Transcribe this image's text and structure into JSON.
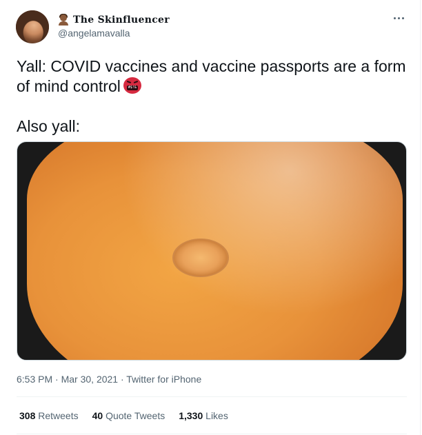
{
  "tweet": {
    "display_name": "The Skinfluencer",
    "handle": "@angelamavalla",
    "text_line1": "Yall:  COVID vaccines and vaccine passports are a form of mind control",
    "text_line2": "Also yall:",
    "emoji_name_icon": "person-icon",
    "emoji_text_icon": "angry-face-with-symbols-icon",
    "time": "6:53 PM",
    "date": "Mar 30, 2021",
    "source": "Twitter for iPhone",
    "separator": "·"
  },
  "stats": {
    "retweets_count": "308",
    "retweets_label": "Retweets",
    "quotes_count": "40",
    "quotes_label": "Quote Tweets",
    "likes_count": "1,330",
    "likes_label": "Likes"
  },
  "colors": {
    "text": "#0f1419",
    "secondary": "#536471",
    "divider": "#eff3f4"
  }
}
